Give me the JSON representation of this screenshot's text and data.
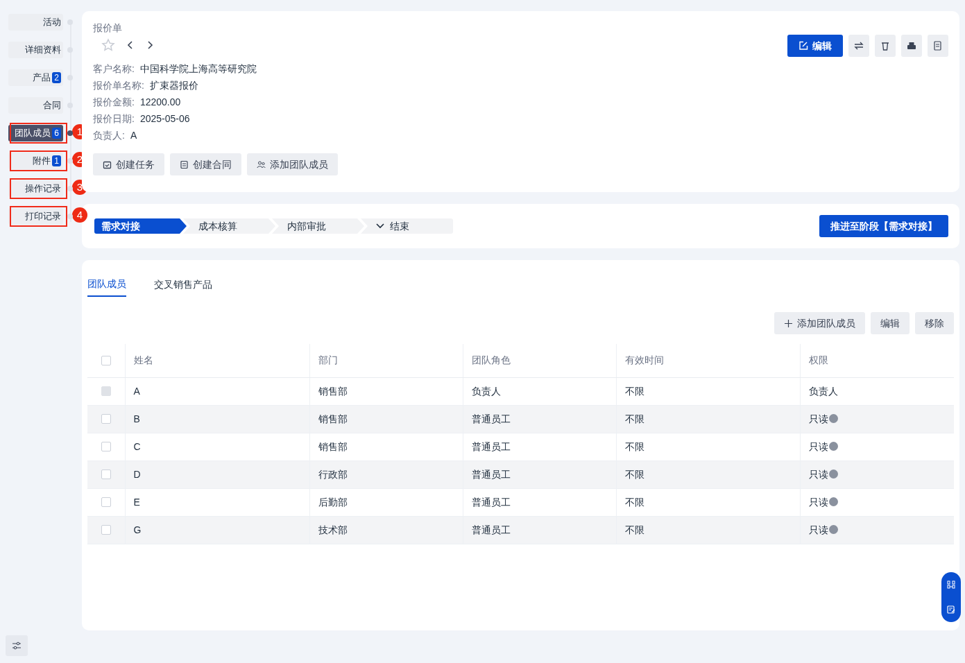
{
  "sidebar": {
    "items": [
      {
        "label": "活动",
        "selected": false
      },
      {
        "label": "详细资料",
        "selected": false
      },
      {
        "label": "产品",
        "badge": "2",
        "selected": false
      },
      {
        "label": "合同",
        "selected": false
      },
      {
        "label": "团队成员",
        "badge": "6",
        "selected": true,
        "callout": "1"
      },
      {
        "label": "附件",
        "badge": "1",
        "selected": false,
        "callout": "2"
      },
      {
        "label": "操作记录",
        "selected": false,
        "callout": "3"
      },
      {
        "label": "打印记录",
        "selected": false,
        "callout": "4"
      }
    ]
  },
  "header": {
    "title": "报价单",
    "edit_button": "编辑",
    "fields": [
      {
        "label": "客户名称:",
        "value": "中国科学院上海高等研究院"
      },
      {
        "label": "报价单名称:",
        "value": "扩束器报价"
      },
      {
        "label": "报价金额:",
        "value": "12200.00"
      },
      {
        "label": "报价日期:",
        "value": "2025-05-06"
      },
      {
        "label": "负责人:",
        "value": "A"
      }
    ],
    "actions": [
      {
        "label": "创建任务",
        "kind": "task"
      },
      {
        "label": "创建合同",
        "kind": "contract"
      },
      {
        "label": "添加团队成员",
        "kind": "team"
      }
    ]
  },
  "stages": {
    "steps": [
      {
        "label": "需求对接",
        "selected": true,
        "kind": "step"
      },
      {
        "label": "成本核算",
        "selected": false,
        "kind": "step"
      },
      {
        "label": "内部审批",
        "selected": false,
        "kind": "step"
      },
      {
        "label": "结束",
        "selected": false,
        "kind": "final"
      }
    ],
    "advance_button": "推进至阶段【需求对接】"
  },
  "detail_tabs": [
    {
      "label": "团队成员",
      "selected": true
    },
    {
      "label": "交叉销售产品",
      "selected": false
    }
  ],
  "toolbar": [
    {
      "label": "添加团队成员",
      "kind": "add"
    },
    {
      "label": "编辑",
      "kind": "plain"
    },
    {
      "label": "移除",
      "kind": "plain"
    }
  ],
  "table": {
    "select_all": {
      "checked": false
    },
    "columns": [
      "姓名",
      "部门",
      "团队角色",
      "有效时间",
      "权限"
    ],
    "rows": [
      {
        "cells": [
          "A",
          "销售部",
          "负责人",
          "不限",
          "负责人"
        ],
        "disabled": true,
        "help": false
      },
      {
        "cells": [
          "B",
          "销售部",
          "普通员工",
          "不限",
          "只读"
        ],
        "disabled": false,
        "help": true
      },
      {
        "cells": [
          "C",
          "销售部",
          "普通员工",
          "不限",
          "只读"
        ],
        "disabled": false,
        "help": true
      },
      {
        "cells": [
          "D",
          "行政部",
          "普通员工",
          "不限",
          "只读"
        ],
        "disabled": false,
        "help": true
      },
      {
        "cells": [
          "E",
          "后勤部",
          "普通员工",
          "不限",
          "只读"
        ],
        "disabled": false,
        "help": true
      },
      {
        "cells": [
          "G",
          "技术部",
          "普通员工",
          "不限",
          "只读"
        ],
        "disabled": false,
        "help": true
      }
    ]
  }
}
